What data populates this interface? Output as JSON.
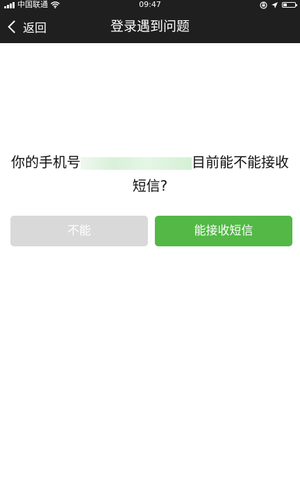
{
  "status_bar": {
    "carrier": "中国联通",
    "time": "09:47",
    "icons": [
      "signal-bars-icon",
      "wifi-icon",
      "orientation-lock-icon",
      "location-arrow-icon",
      "battery-icon"
    ],
    "battery_level": 0.3
  },
  "nav": {
    "back_label": "返回",
    "title": "登录遇到问题"
  },
  "question": {
    "prefix": "你的手机号",
    "suffix": "目前能不能接收短信?"
  },
  "buttons": {
    "no_label": "不能",
    "yes_label": "能接收短信"
  },
  "colors": {
    "bar_background": "#1f1f1f",
    "primary_green": "#53b846",
    "disabled_gray": "#d9d9d9"
  }
}
